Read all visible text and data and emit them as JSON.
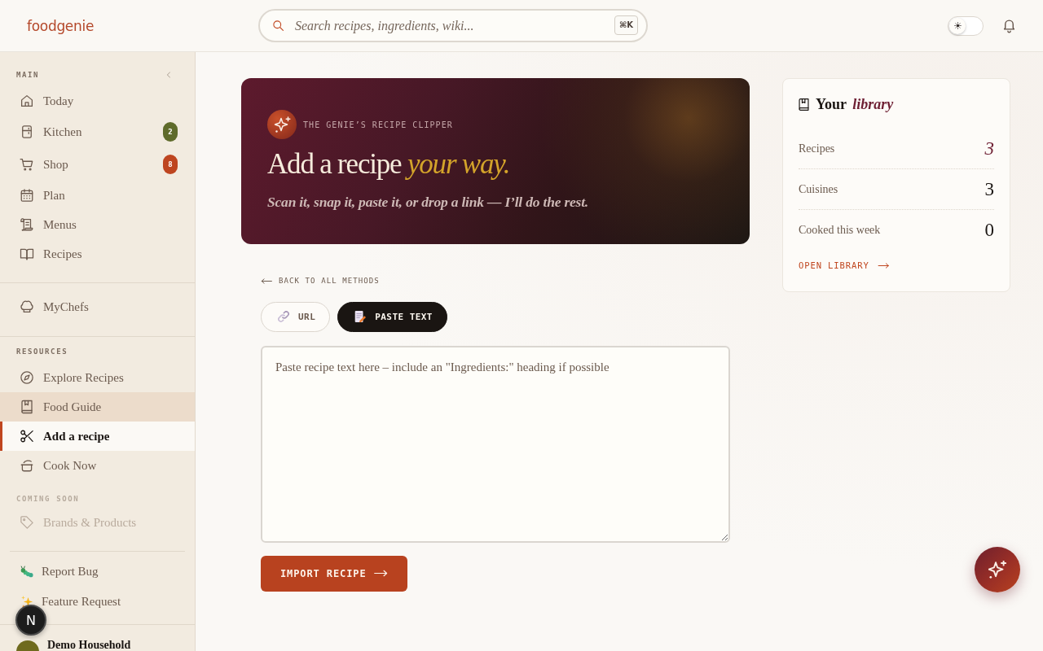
{
  "header": {
    "logo": "foodgenie",
    "search": {
      "placeholder": "Search recipes, ingredients, wiki...",
      "shortcut": "⌘K"
    },
    "dark_mode": false
  },
  "sidebar": {
    "groups": [
      {
        "sections": [
          {
            "title": "MAIN",
            "items": [
              {
                "label": "Today",
                "selected": false,
                "hovered": false,
                "disabled": false
              },
              {
                "label": "Kitchen",
                "selected": false,
                "hovered": false,
                "disabled": false,
                "badge": {
                  "text": "2",
                  "color": "#5f6b2b"
                }
              },
              {
                "label": "Shop",
                "selected": false,
                "hovered": false,
                "disabled": false,
                "badge": {
                  "text": "8",
                  "color": "#be4520"
                }
              },
              {
                "label": "Plan",
                "selected": false,
                "hovered": false,
                "disabled": false
              },
              {
                "label": "Menus",
                "selected": false,
                "hovered": false,
                "disabled": false
              },
              {
                "label": "Recipes",
                "selected": false,
                "hovered": false,
                "disabled": false
              }
            ]
          }
        ]
      },
      {
        "sections": [
          {
            "items": [
              {
                "label": "MyChefs",
                "selected": false,
                "hovered": false,
                "disabled": false
              }
            ]
          }
        ]
      },
      {
        "sections": [
          {
            "title": "RESOURCES",
            "items": [
              {
                "label": "Explore Recipes",
                "selected": false,
                "hovered": false,
                "disabled": false
              },
              {
                "label": "Food Guide",
                "selected": false,
                "hovered": true,
                "disabled": false
              },
              {
                "label": "Add a recipe",
                "selected": true,
                "hovered": false,
                "disabled": false
              },
              {
                "label": "Cook Now",
                "selected": false,
                "hovered": false,
                "disabled": false
              }
            ]
          },
          {
            "title": "COMING SOON",
            "items": [
              {
                "label": "Brands & Products",
                "selected": false,
                "hovered": false,
                "disabled": true
              }
            ]
          }
        ]
      }
    ],
    "footer_links": [
      {
        "label": "Report Bug"
      },
      {
        "label": "Feature Request"
      }
    ],
    "household": {
      "name": "Demo Household"
    }
  },
  "hero": {
    "eyebrow": "THE GENIE’S RECIPE CLIPPER",
    "title": "Add a recipe *your way.*",
    "subtitle": "Scan it, snap it, paste it, or drop a link — I’ll do the rest."
  },
  "back_link": "BACK TO ALL METHODS",
  "tabs": [
    {
      "label": "URL",
      "selected": false
    },
    {
      "label": "PASTE TEXT",
      "selected": true
    }
  ],
  "editor": {
    "placeholder": "Paste recipe text here – include an \"Ingredients:\" heading if possible"
  },
  "submit_button": "IMPORT RECIPE",
  "library": {
    "title": "Your *library*",
    "stats": [
      {
        "label": "Recipes",
        "value": "3",
        "emphasized": true
      },
      {
        "label": "Cuisines",
        "value": "3",
        "emphasized": false
      },
      {
        "label": "Cooked this week",
        "value": "0",
        "emphasized": false
      }
    ],
    "link": "OPEN LIBRARY"
  },
  "dev_indicator": "N"
}
